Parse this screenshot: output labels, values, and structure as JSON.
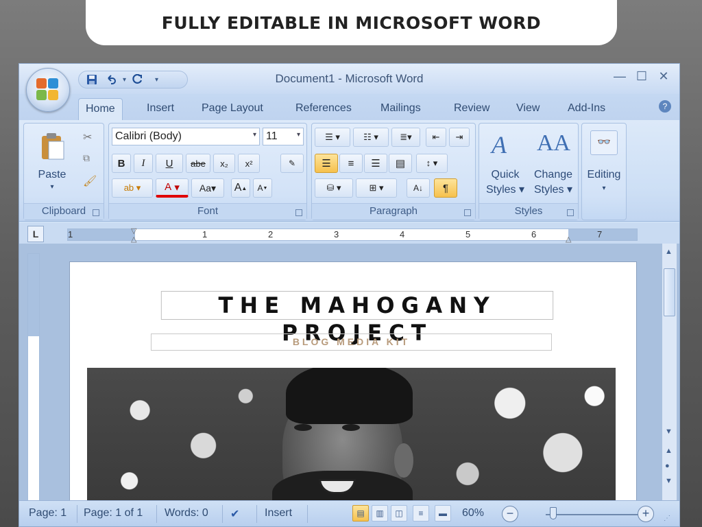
{
  "banner": {
    "text": "FULLY EDITABLE IN MICROSOFT WORD"
  },
  "window": {
    "title": "Document1 - Microsoft Word",
    "controls": {
      "minimize": "—",
      "maximize": "☐",
      "close": "✕"
    }
  },
  "quick_access": {
    "save": "💾",
    "undo": "↶",
    "redo": "↻",
    "more": "▾"
  },
  "tabs": [
    "Home",
    "Insert",
    "Page Layout",
    "References",
    "Mailings",
    "Review",
    "View",
    "Add-Ins"
  ],
  "ribbon": {
    "clipboard": {
      "label": "Clipboard",
      "paste": "Paste"
    },
    "font": {
      "label": "Font",
      "family": "Calibri (Body)",
      "size": "11",
      "bold": "B",
      "italic": "I",
      "underline": "U",
      "strike": "abe",
      "subscript": "x₂",
      "superscript": "x²",
      "change_case": "Aa",
      "grow": "A",
      "shrink": "A",
      "font_color": "A"
    },
    "paragraph": {
      "label": "Paragraph",
      "show_marks": "¶",
      "sort": "A↓"
    },
    "styles": {
      "label": "Styles",
      "quick_styles": [
        "Quick",
        "Styles"
      ],
      "change_styles": [
        "Change",
        "Styles"
      ]
    },
    "editing": {
      "label": "Editing"
    }
  },
  "ruler": {
    "numbers": [
      "1",
      "1",
      "2",
      "3",
      "4",
      "5",
      "6",
      "7"
    ]
  },
  "document": {
    "title": "THE MAHOGANY PROJECT",
    "subtitle": "BLOG MEDIA KIT"
  },
  "statusbar": {
    "page": "Page: 1",
    "page_of": "Page: 1 of 1",
    "words": "Words: 0",
    "mode": "Insert",
    "zoom": "60%",
    "zoom_minus": "−",
    "zoom_plus": "+"
  }
}
